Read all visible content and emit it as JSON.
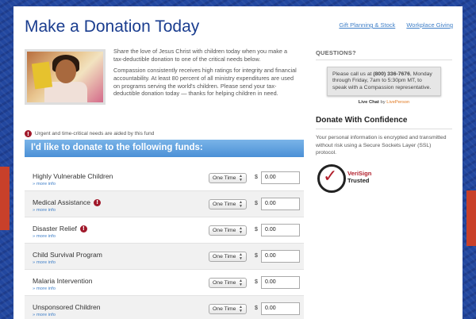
{
  "page": {
    "title": "Make a Donation Today",
    "links": [
      "Gift Planning & Stock",
      "Workplace Giving"
    ]
  },
  "intro": {
    "p1": "Share the love of Jesus Christ with children today when you make a tax-deductible donation to one of the critical needs below.",
    "p2": "Compassion consistently receives high ratings for integrity and financial accountability. At least 80 percent of all ministry expenditures are used on programs serving the world's children. Please send your tax-deductible donation today — thanks for helping children in need."
  },
  "urgent_note": "Urgent and time-critical needs are aided by this fund",
  "funds_heading": "I'd like to donate to the following funds:",
  "funds": [
    {
      "name": "Highly Vulnerable Children",
      "urgent": false,
      "more": "» more info",
      "frequency": "One Time",
      "currency": "$",
      "amount": "0.00"
    },
    {
      "name": "Medical Assistance",
      "urgent": true,
      "more": "» more info",
      "frequency": "One Time",
      "currency": "$",
      "amount": "0.00"
    },
    {
      "name": "Disaster Relief",
      "urgent": true,
      "more": "» more info",
      "frequency": "One Time",
      "currency": "$",
      "amount": "0.00"
    },
    {
      "name": "Child Survival Program",
      "urgent": false,
      "more": "» more info",
      "frequency": "One Time",
      "currency": "$",
      "amount": "0.00"
    },
    {
      "name": "Malaria Intervention",
      "urgent": false,
      "more": "» more info",
      "frequency": "One Time",
      "currency": "$",
      "amount": "0.00"
    },
    {
      "name": "Unsponsored Children",
      "urgent": false,
      "more": "» more info",
      "frequency": "One Time",
      "currency": "$",
      "amount": "0.00"
    }
  ],
  "sidebar": {
    "questions_label": "QUESTIONS?",
    "call_text_pre": "Please call us at ",
    "phone": "(800) 336-7676",
    "call_text_post": ", Monday through Friday, 7am to 5:30pm MT, to speak with a Compassion representative.",
    "live_chat": "Live Chat",
    "by": "by",
    "liveperson": "LivePerson",
    "confidence_heading": "Donate With Confidence",
    "confidence_text": "Your personal information is encrypted and transmitted without risk using a Secure Sockets Layer (SSL) protocol.",
    "verisign_line1": "VeriSign",
    "verisign_line2": "Trusted"
  },
  "colors": {
    "title": "#1a3d8f",
    "funds_header": "#4b90d6",
    "link": "#3f7fc8",
    "urgent": "#a0182a"
  }
}
